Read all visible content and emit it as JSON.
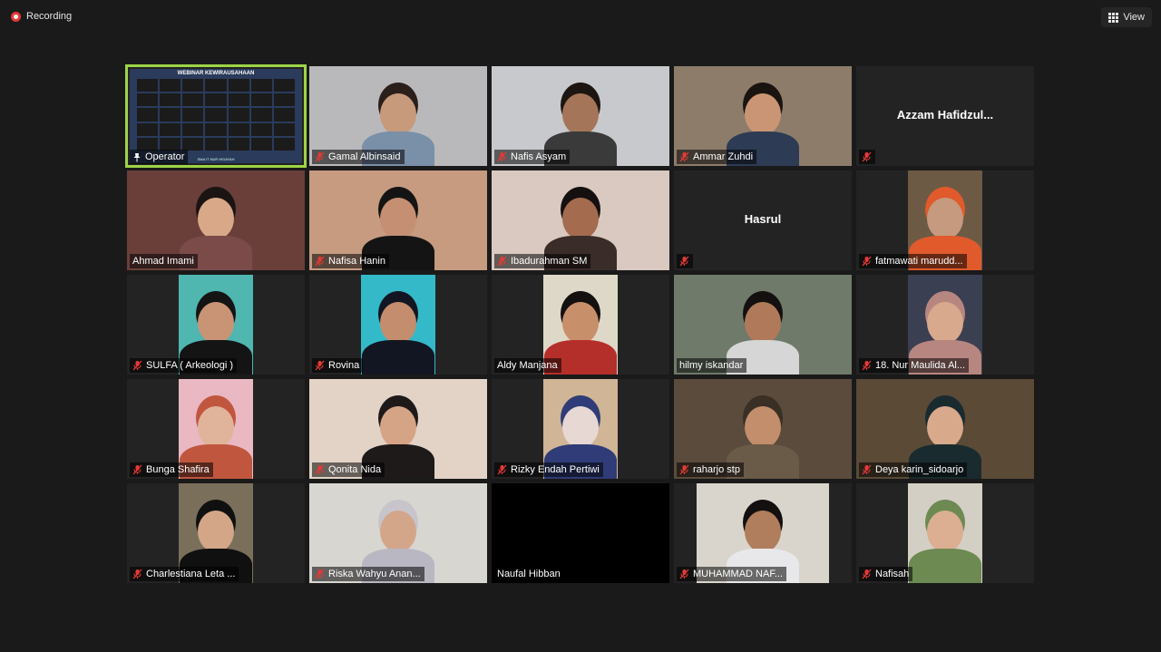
{
  "recording": {
    "label": "Recording"
  },
  "view_button": {
    "label": "View",
    "icon": "grid-icon"
  },
  "operator_slide": {
    "title": "WEBINAR KEWIRAUSAHAAN",
    "footer": "SMA IT NUR HIDAYAH"
  },
  "colors": {
    "active_border": "#9ed447",
    "mute_red": "#e53935",
    "tile_bg": "#232323",
    "app_bg": "#1a1a1a"
  },
  "participants": [
    {
      "name": "Operator",
      "video": "slide",
      "muted": false,
      "pinned": true,
      "active": true
    },
    {
      "name": "Gamal Albinsaid",
      "video": "full",
      "muted": true,
      "bg": "#b9b9bb",
      "skin": "#c79a7c",
      "shirt": "#7a8fa8",
      "hair": "#2a1f1a"
    },
    {
      "name": "Nafis Asyam",
      "video": "full",
      "muted": true,
      "bg": "#c7c9cc",
      "skin": "#a57559",
      "shirt": "#3a3a3a",
      "hair": "#1c1512"
    },
    {
      "name": "Ammar Zuhdi",
      "video": "full",
      "muted": true,
      "bg": "#8d7c6a",
      "skin": "#c99575",
      "shirt": "#2d3b54",
      "hair": "#1a1410"
    },
    {
      "name": "Azzam  Hafidzul...",
      "video": "none",
      "muted": true,
      "display": "Azzam  Hafidzul..."
    },
    {
      "name": "Ahmad Imami",
      "video": "full",
      "muted": false,
      "bg": "#6a3f3a",
      "skin": "#d8a888",
      "shirt": "#7b4b49",
      "hair": "#1a1412"
    },
    {
      "name": "Nafisa Hanin",
      "video": "full",
      "muted": true,
      "bg": "#c69b80",
      "skin": "#c58f73",
      "shirt": "#141414",
      "hair": "#141414"
    },
    {
      "name": "Ibadurahman SM",
      "video": "full",
      "muted": true,
      "bg": "#d9c9c1",
      "skin": "#a56b4e",
      "shirt": "#3a2c28",
      "hair": "#141010"
    },
    {
      "name": "Hasrul",
      "video": "none",
      "muted": true,
      "display": "Hasrul"
    },
    {
      "name": "fatmawati marudd...",
      "video": "narrow",
      "muted": true,
      "bg": "#6c5a45",
      "skin": "#c59a7e",
      "shirt": "#e05a2b",
      "hair": "#e05a2b"
    },
    {
      "name": "SULFA ( Arkeologi )",
      "video": "narrow",
      "muted": true,
      "bg": "#4fb6b0",
      "skin": "#c99475",
      "shirt": "#141414",
      "hair": "#141414"
    },
    {
      "name": "Rovina",
      "video": "narrow",
      "muted": true,
      "bg": "#34b9c9",
      "skin": "#c48d6d",
      "shirt": "#121622",
      "hair": "#121622"
    },
    {
      "name": "Aldy Manjana",
      "video": "narrow",
      "muted": false,
      "bg": "#ded8c8",
      "skin": "#c78f6a",
      "shirt": "#b52f2a",
      "hair": "#141010"
    },
    {
      "name": "hilmy iskandar",
      "video": "full",
      "muted": false,
      "bg": "#6f7a6a",
      "skin": "#b07a5a",
      "shirt": "#d6d6d6",
      "hair": "#141010"
    },
    {
      "name": "18. Nur Maulida Al...",
      "video": "narrow",
      "muted": true,
      "bg": "#3b3f52",
      "skin": "#d8a98c",
      "shirt": "#b88680",
      "hair": "#b88680"
    },
    {
      "name": "Bunga Shafira",
      "video": "narrow",
      "muted": true,
      "bg": "#e9b8c2",
      "skin": "#e0b49a",
      "shirt": "#c1563f",
      "hair": "#c1563f"
    },
    {
      "name": "Qonita Nida",
      "video": "full",
      "muted": true,
      "bg": "#e3d3c7",
      "skin": "#d5a487",
      "shirt": "#1e1a1a",
      "hair": "#1e1a1a"
    },
    {
      "name": "Rizky Endah Pertiwi",
      "video": "narrow",
      "muted": true,
      "bg": "#d0b596",
      "skin": "#e7d8d3",
      "shirt": "#2f3c77",
      "hair": "#2f3c77"
    },
    {
      "name": "raharjo stp",
      "video": "full",
      "muted": true,
      "bg": "#5a4b3c",
      "skin": "#c28e6b",
      "shirt": "#6a5a48",
      "hair": "#3a2f25"
    },
    {
      "name": "Deya karin_sidoarjo",
      "video": "full",
      "muted": true,
      "bg": "#5a4a36",
      "skin": "#d9a98b",
      "shirt": "#1a2b30",
      "hair": "#1a2b30"
    },
    {
      "name": "Charlestiana Leta ...",
      "video": "narrow",
      "muted": true,
      "bg": "#7a6f5a",
      "skin": "#d3a688",
      "shirt": "#101010",
      "hair": "#101010"
    },
    {
      "name": "Riska Wahyu Anan...",
      "video": "full",
      "muted": true,
      "bg": "#d8d6d0",
      "skin": "#d3a68a",
      "shirt": "#b9b7c2",
      "hair": "#c8c4cc"
    },
    {
      "name": "Naufal Hibban",
      "video": "black",
      "muted": false
    },
    {
      "name": "MUHAMMAD NAF...",
      "video": "wide",
      "muted": true,
      "bg": "#d9d5cc",
      "skin": "#b07e5d",
      "shirt": "#e8e8ea",
      "hair": "#141010"
    },
    {
      "name": "Nafisah",
      "video": "narrow",
      "muted": true,
      "bg": "#d4cfc4",
      "skin": "#dcae92",
      "shirt": "#6c8a52",
      "hair": "#6c8a52"
    }
  ]
}
